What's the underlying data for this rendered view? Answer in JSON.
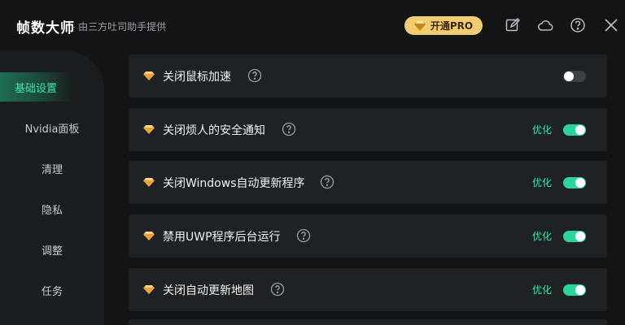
{
  "app": {
    "title": "帧数大师",
    "subtitle": "- 由三方吐司助手提供",
    "pro_button": "开通PRO"
  },
  "icons": {
    "pro": "diamond-icon",
    "edit": "edit-icon",
    "cloud": "cloud-icon",
    "help": "help-circle-icon",
    "close": "close-icon"
  },
  "colors": {
    "accent": "#3fe3a8",
    "toggle_on": "#2ed39b",
    "pro_gold": "#f2cc73",
    "background": "#121416",
    "row": "#1f2224"
  },
  "sidebar": {
    "items": [
      {
        "label": "基础设置",
        "active": true
      },
      {
        "label": "Nvidia面板",
        "active": false
      },
      {
        "label": "清理",
        "active": false
      },
      {
        "label": "隐私",
        "active": false
      },
      {
        "label": "调整",
        "active": false
      },
      {
        "label": "任务",
        "active": false
      }
    ]
  },
  "settings": [
    {
      "label": "关闭鼠标加速",
      "status": "",
      "enabled": false
    },
    {
      "label": "关闭烦人的安全通知",
      "status": "优化",
      "enabled": true
    },
    {
      "label": "关闭Windows自动更新程序",
      "status": "优化",
      "enabled": true
    },
    {
      "label": "禁用UWP程序后台运行",
      "status": "优化",
      "enabled": true
    },
    {
      "label": "关闭自动更新地图",
      "status": "优化",
      "enabled": true
    }
  ]
}
